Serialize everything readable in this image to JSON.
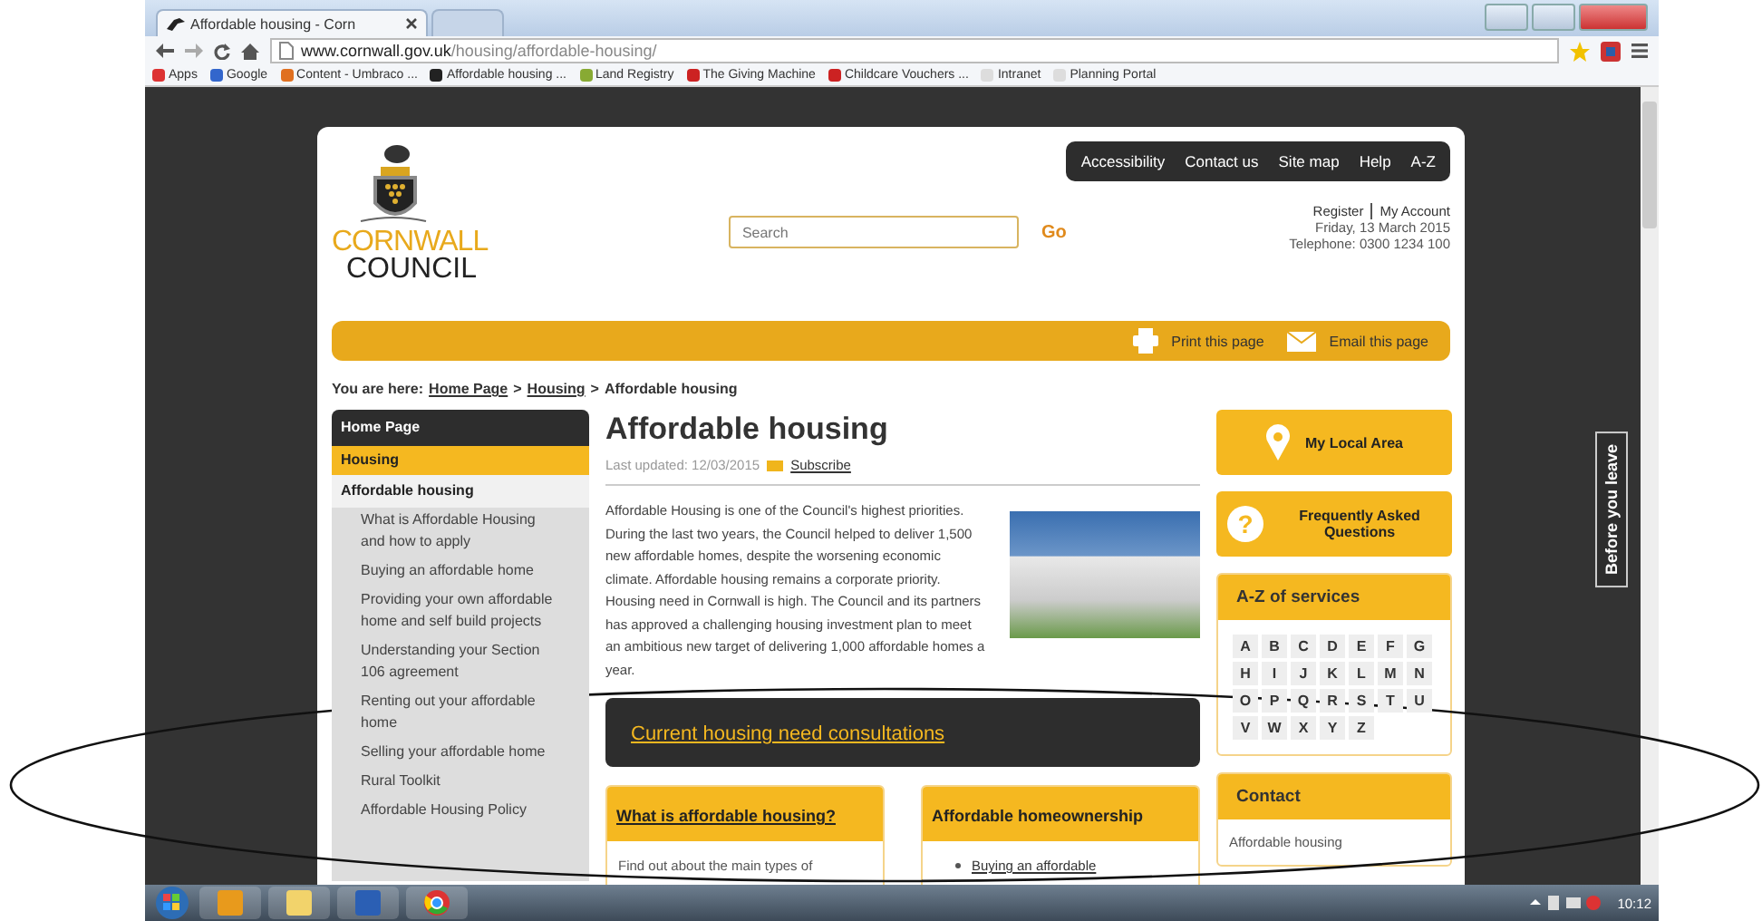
{
  "browser": {
    "tabs": [
      {
        "title": "Affordable housing - Corn",
        "selected": true
      },
      {
        "selected": false
      }
    ],
    "url_host": "www.cornwall.gov.uk",
    "url_path": "/housing/affordable-housing/",
    "bookmarks": [
      "Apps",
      "Google",
      "Content - Umbraco ...",
      "Affordable housing ...",
      "Land Registry",
      "The Giving Machine",
      "Childcare Vouchers ...",
      "Intranet",
      "Planning Portal"
    ]
  },
  "header": {
    "top_links": [
      "Accessibility",
      "Contact us",
      "Site map",
      "Help",
      "A-Z"
    ],
    "logo": [
      "CORNWALL",
      "COUNCIL"
    ],
    "search": {
      "placeholder": "Search",
      "button": "Go"
    },
    "account": [
      "Register",
      "My Account"
    ],
    "date": "Friday, 13 March 2015",
    "phone": "Telephone: 0300 1234 100",
    "tools": [
      "Print this page",
      "Email this page"
    ]
  },
  "breadcrumb": {
    "label": "You are here:",
    "separator": ">",
    "items": [
      "Home Page",
      "Housing",
      "Affordable housing"
    ]
  },
  "sidebar": {
    "items": [
      {
        "label": "Home Page",
        "children": [
          {
            "label": "Housing",
            "children": [
              {
                "label": "Affordable housing",
                "children": [
                  {
                    "label": "What is Affordable Housing and how to apply"
                  },
                  {
                    "label": "Buying an affordable home"
                  },
                  {
                    "label": "Providing your own affordable home and self build projects"
                  },
                  {
                    "label": "Understanding your Section 106 agreement"
                  },
                  {
                    "label": "Renting out your affordable home"
                  },
                  {
                    "label": "Selling your affordable home"
                  },
                  {
                    "label": "Rural Toolkit"
                  },
                  {
                    "label": "Affordable Housing Policy"
                  }
                ]
              }
            ]
          }
        ]
      }
    ]
  },
  "main": {
    "title": "Affordable housing",
    "last_updated": "Last updated: 12/03/2015",
    "subscribe": "Subscribe",
    "intro": "Affordable Housing is one of the Council's highest priorities. During the last two years, the Council helped to deliver 1,500 new affordable homes, despite the worsening economic climate. Affordable housing remains a corporate priority. Housing need in Cornwall is high. The Council and its partners has approved a challenging housing investment plan to meet an ambitious new target of delivering 1,000 affordable homes a year.",
    "banner": "Current housing need consultations",
    "boxes": [
      {
        "kind": "text",
        "title": "What is affordable housing?",
        "body": "Find out about the main types of"
      },
      {
        "kind": "list",
        "title": "Affordable homeownership",
        "links": [
          "Buying an affordable"
        ]
      }
    ]
  },
  "aside": {
    "buttons": [
      {
        "kind": "pin",
        "label": "My Local Area"
      },
      {
        "kind": "question",
        "icon": "?",
        "label": "Frequently Asked Questions"
      }
    ],
    "az_title": "A-Z of services",
    "letters": [
      "A",
      "B",
      "C",
      "D",
      "E",
      "F",
      "G",
      "H",
      "I",
      "J",
      "K",
      "L",
      "M",
      "N",
      "O",
      "P",
      "Q",
      "R",
      "S",
      "T",
      "U",
      "V",
      "W",
      "X",
      "Y",
      "Z"
    ],
    "contact_title": "Contact",
    "contact_body": "Affordable housing"
  },
  "side_tab": "Before you leave",
  "taskbar": {
    "time": "10:12"
  }
}
